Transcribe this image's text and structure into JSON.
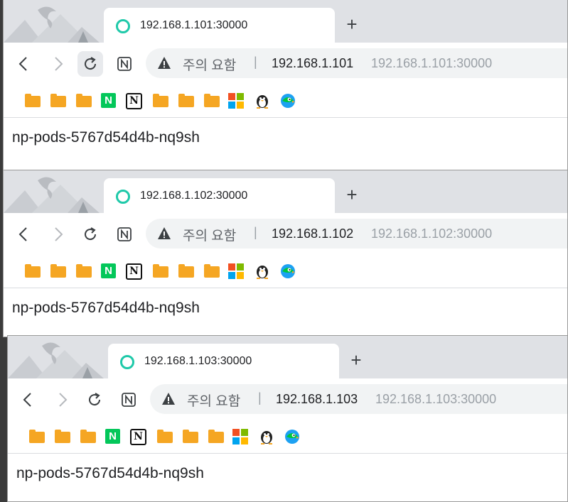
{
  "windows": [
    {
      "tab_title": "192.168.1.101:30000",
      "warning_text": "주의 요함",
      "separator": "|",
      "host": "192.168.1.101",
      "url": "192.168.1.101:30000",
      "page_text": "np-pods-5767d54d4b-nq9sh"
    },
    {
      "tab_title": "192.168.1.102:30000",
      "warning_text": "주의 요함",
      "separator": "|",
      "host": "192.168.1.102",
      "url": "192.168.1.102:30000",
      "page_text": "np-pods-5767d54d4b-nq9sh"
    },
    {
      "tab_title": "192.168.1.103:30000",
      "warning_text": "주의 요함",
      "separator": "|",
      "host": "192.168.1.103",
      "url": "192.168.1.103:30000",
      "page_text": "np-pods-5767d54d4b-nq9sh"
    }
  ],
  "toolbar": {
    "new_tab_glyph": "+",
    "naver_letter": "N",
    "notion_letter": "N"
  },
  "colors": {
    "tab_icon": "#1fc9a9",
    "folder": "#f5a623",
    "naver": "#03c75a",
    "tabstrip": "#dfe1e5"
  },
  "icons": [
    "back-icon",
    "forward-icon",
    "reload-icon",
    "notion-extension-icon",
    "warning-icon",
    "folder-icon",
    "naver-icon",
    "notion-icon",
    "microsoft-icon",
    "penguin-icon",
    "papago-icon"
  ]
}
